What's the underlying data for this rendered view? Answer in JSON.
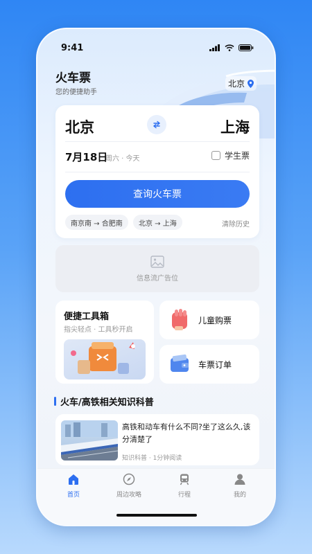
{
  "status": {
    "time": "9:41"
  },
  "header": {
    "title": "火车票",
    "subtitle": "您的便捷助手",
    "location": "北京"
  },
  "search": {
    "from": "北京",
    "to": "上海",
    "date": "7月18日",
    "weekday": "周六 · 今天",
    "student_label": "学生票",
    "student_checked": false,
    "button_label": "查询火车票",
    "history": [
      "南京南 → 合肥南",
      "北京 → 上海"
    ],
    "clear_label": "清除历史"
  },
  "ad": {
    "label": "信息流广告位"
  },
  "tools": {
    "toolbox_title": "便捷工具箱",
    "toolbox_subtitle": "指尖轻点 · 工具秒开启",
    "child_ticket": "儿童购票",
    "ticket_orders": "车票订单"
  },
  "knowledge": {
    "section_title": "火车/高铁相关知识科普",
    "article_title": "高铁和动车有什么不同?坐了这么久,该分清楚了",
    "article_meta": "知识科普 · 1分钟阅读"
  },
  "tabs": [
    {
      "label": "首页",
      "icon": "home-icon",
      "active": true
    },
    {
      "label": "周边攻略",
      "icon": "compass-icon",
      "active": false
    },
    {
      "label": "行程",
      "icon": "train-icon",
      "active": false
    },
    {
      "label": "我的",
      "icon": "user-icon",
      "active": false
    }
  ],
  "colors": {
    "accent": "#2d6ff0",
    "background_top": "#2f86f4",
    "card": "#ffffff"
  }
}
